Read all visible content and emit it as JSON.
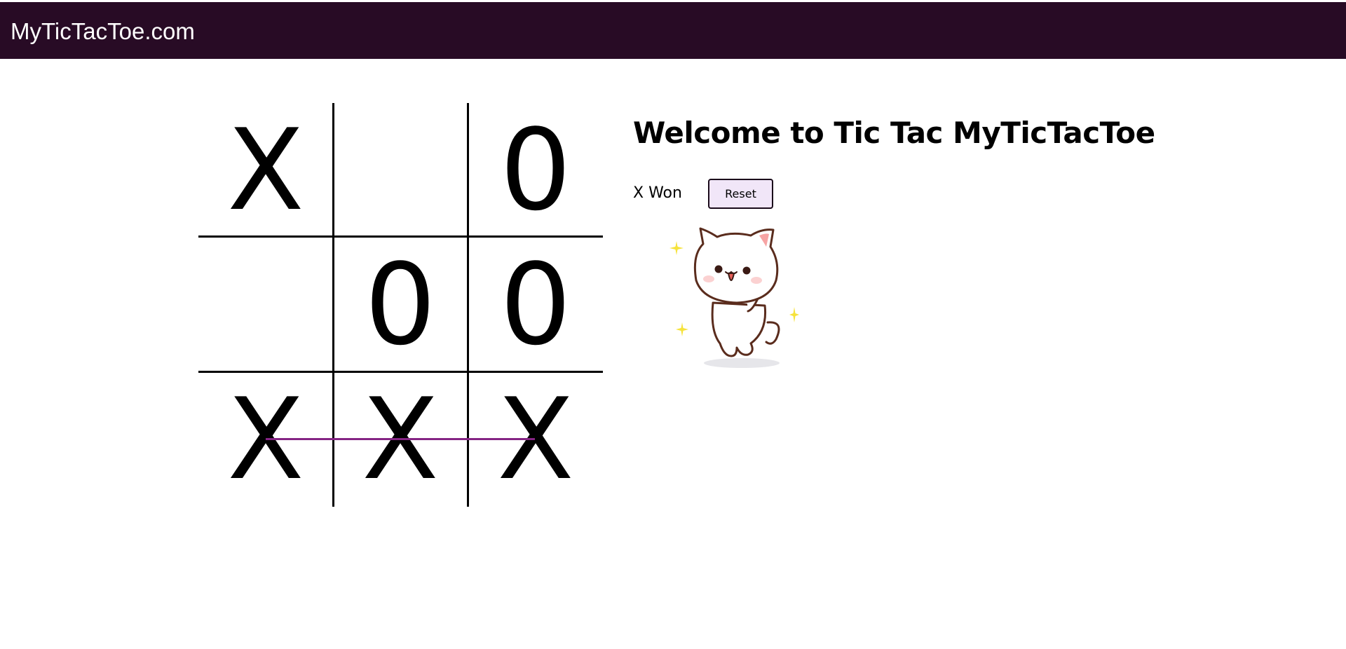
{
  "header": {
    "site_title": "MyTicTacToe.com",
    "background_color": "#280b25"
  },
  "board": {
    "cells": [
      [
        "X",
        "",
        "0"
      ],
      [
        "",
        "0",
        "0"
      ],
      [
        "X",
        "X",
        "X"
      ]
    ],
    "winning_row": 3,
    "win_line_color": "#852484"
  },
  "main": {
    "welcome_heading": "Welcome to Tic Tac MyTicTacToe",
    "status_text": "X Won",
    "reset_label": "Reset",
    "reset_button_color": "#f1e6f8",
    "celebration_image": "dancing-cat-sticker"
  }
}
